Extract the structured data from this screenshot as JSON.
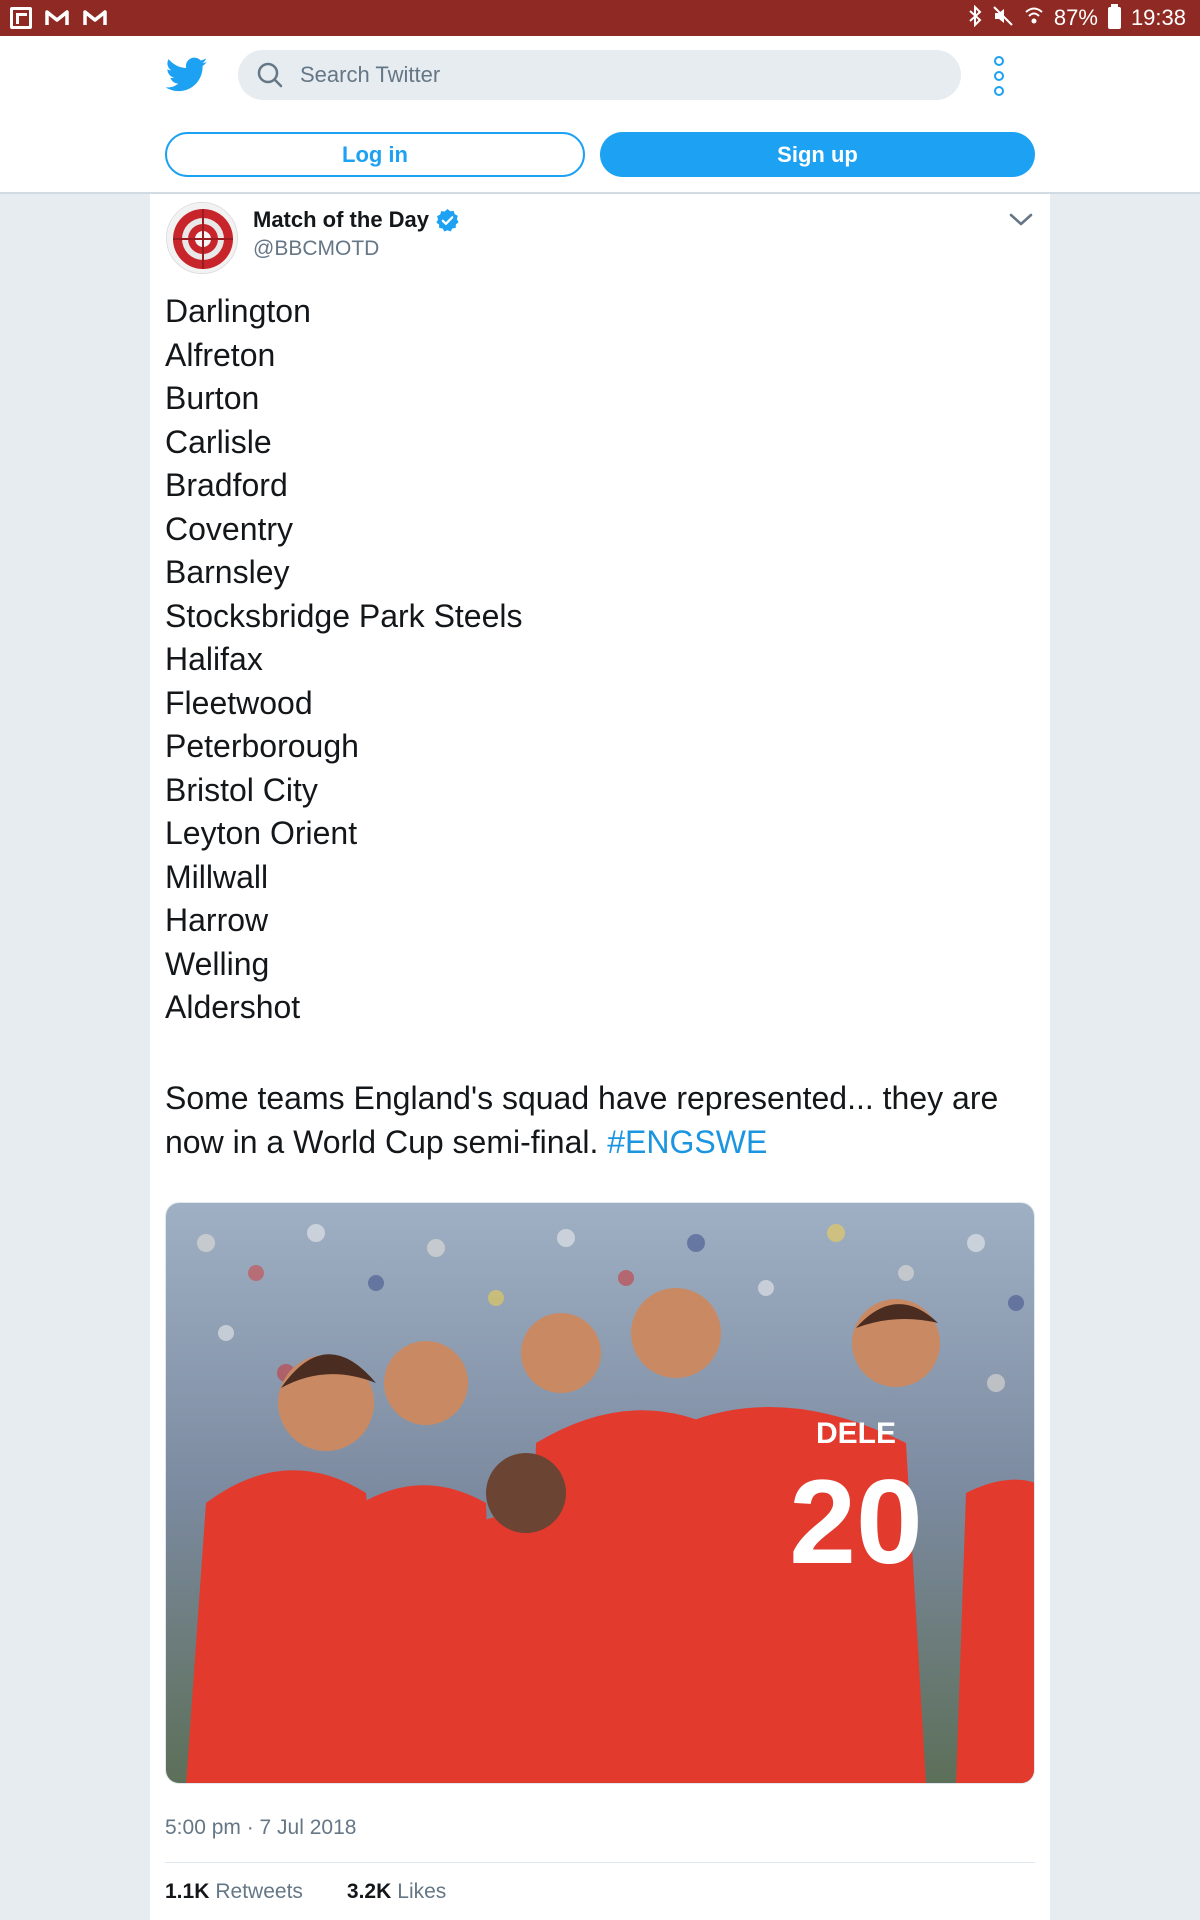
{
  "status_bar": {
    "battery": "87%",
    "time": "19:38"
  },
  "header": {
    "search_placeholder": "Search Twitter",
    "login_label": "Log in",
    "signup_label": "Sign up",
    "brand_color": "#1da1f2"
  },
  "tweet": {
    "author_name": "Match of the Day",
    "author_handle": "@BBCMOTD",
    "clubs": [
      "Darlington",
      "Alfreton",
      "Burton",
      "Carlisle",
      "Bradford",
      "Coventry",
      "Barnsley",
      "Stocksbridge Park Steels",
      "Halifax",
      "Fleetwood",
      "Peterborough",
      "Bristol City",
      "Leyton Orient",
      "Millwall",
      "Harrow",
      "Welling",
      "Aldershot"
    ],
    "body_text": "Some teams England's squad have represented... they are now in a World Cup semi-final. ",
    "hashtag": "#ENGSWE",
    "photo": {
      "shirt_name": "DELE",
      "shirt_number": "20"
    },
    "timestamp": "5:00 pm · 7 Jul 2018",
    "retweets_count": "1.1K",
    "retweets_label": "Retweets",
    "likes_count": "3.2K",
    "likes_label": "Likes"
  }
}
